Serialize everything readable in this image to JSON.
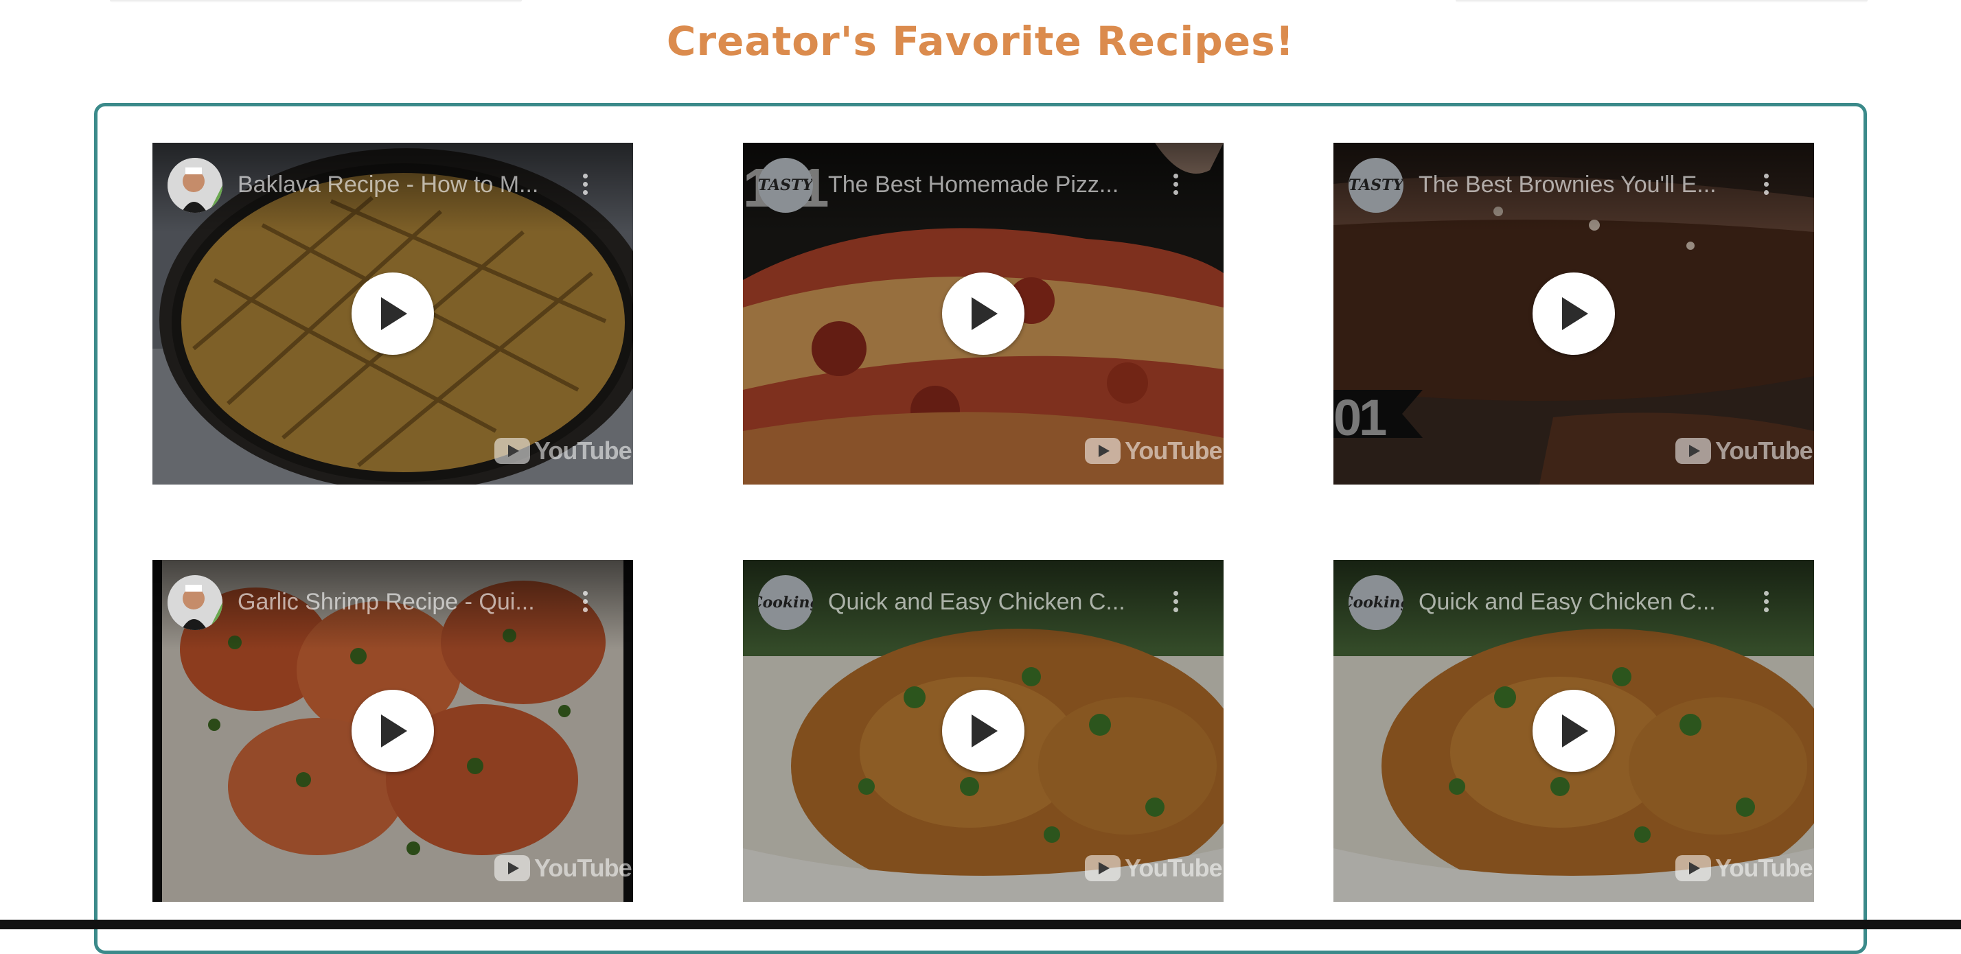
{
  "page": {
    "title": "Creator's Favorite Recipes!"
  },
  "brand_colors": {
    "title_orange": "#db8b4d",
    "panel_border_teal": "#3b8a8a"
  },
  "videos": [
    {
      "title": "Baklava Recipe - How to M...",
      "channel_avatar_icon": "chef-avatar",
      "platform_label": "YouTube",
      "thumbnail": "baklava-tray"
    },
    {
      "title": "The Best Homemade Pizz...",
      "channel_avatar_text": "TASTY",
      "platform_label": "YouTube",
      "thumbnail": "pizza-slice"
    },
    {
      "title": "The Best Brownies You'll E...",
      "channel_avatar_text": "TASTY",
      "platform_label": "YouTube",
      "thumbnail": "brownie"
    },
    {
      "title": "Garlic Shrimp Recipe - Qui...",
      "channel_avatar_icon": "chef-avatar",
      "platform_label": "YouTube",
      "thumbnail": "garlic-shrimp"
    },
    {
      "title": "Quick and Easy Chicken C...",
      "channel_avatar_text": "Cooking",
      "platform_label": "YouTube",
      "thumbnail": "chicken-curry"
    },
    {
      "title": "Quick and Easy Chicken C...",
      "channel_avatar_text": "Cooking",
      "platform_label": "YouTube",
      "thumbnail": "chicken-curry"
    }
  ]
}
